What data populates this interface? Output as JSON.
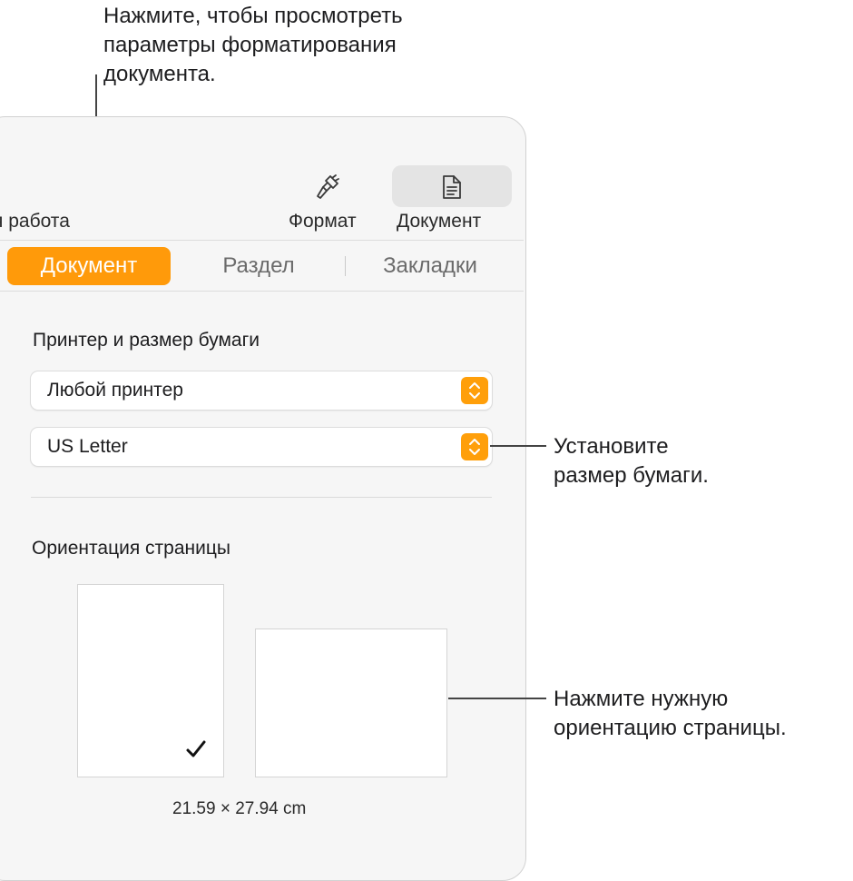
{
  "callouts": {
    "top": [
      "Нажмите, чтобы просмотреть",
      "параметры форматирования",
      "документа."
    ],
    "paper": [
      "Установите",
      "размер бумаги."
    ],
    "orientation": [
      "Нажмите нужную",
      "ориентацию страницы."
    ]
  },
  "toolbar": {
    "layout_label": "я работа",
    "format_label": "Формат",
    "format_icon": "paintbrush-icon",
    "document_label": "Документ",
    "document_icon": "document-icon"
  },
  "tabs": [
    {
      "label": "Документ",
      "active": true
    },
    {
      "label": "Раздел",
      "active": false
    },
    {
      "label": "Закладки",
      "active": false
    }
  ],
  "printer_section": {
    "title": "Принтер и размер бумаги",
    "printer_value": "Любой принтер",
    "paper_value": "US Letter"
  },
  "orientation_section": {
    "title": "Ориентация страницы",
    "selected": "portrait",
    "dimensions": "21.59 × 27.94 cm"
  },
  "colors": {
    "accent": "#ff9a0a",
    "panel_bg": "#f6f6f6"
  }
}
